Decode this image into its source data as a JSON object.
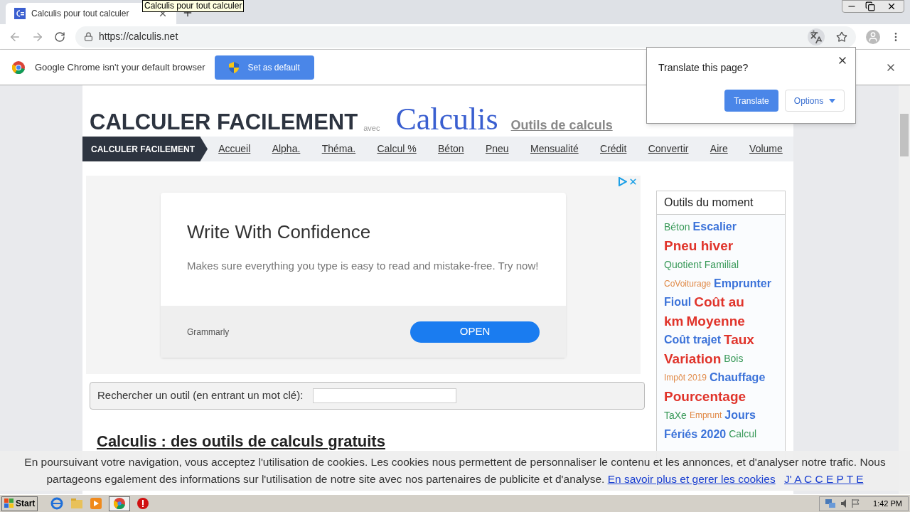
{
  "browser": {
    "tab_title": "Calculis pour tout calculer",
    "tooltip": "Calculis pour tout calculer",
    "url": "https://calculis.net"
  },
  "infobar": {
    "message": "Google Chrome isn't your default browser",
    "button": "Set as default"
  },
  "translate_popup": {
    "title": "Translate this page?",
    "translate_button": "Translate",
    "options_button": "Options"
  },
  "site": {
    "logo_main": "CALCULER FACILEMENT",
    "logo_with": "avec",
    "logo_brand": "Calculis",
    "logo_link": "Outils de calculs"
  },
  "nav": {
    "label": "CALCULER FACILEMENT",
    "items": [
      "Accueil",
      "Alpha.",
      "Théma.",
      "Calcul %",
      "Béton",
      "Pneu",
      "Mensualité",
      "Crédit",
      "Convertir",
      "Aire",
      "Volume"
    ]
  },
  "ad": {
    "title": "Write With Confidence",
    "body": "Makes sure everything you type is easy to read and mistake-free. Try now!",
    "advertiser": "Grammarly",
    "button": "OPEN"
  },
  "search": {
    "label": "Rechercher un outil (en entrant un mot clé):"
  },
  "heading": "Calculis : des outils de calculs gratuits",
  "sidebar": {
    "title": "Outils du moment",
    "lines": [
      [
        {
          "text": "Béton",
          "kind": "small",
          "color": "#3a9a5a"
        },
        {
          "text": "Escalier",
          "kind": "medium",
          "color": "#3b72d9"
        }
      ],
      [
        {
          "text": "Pneu hiver",
          "kind": "large",
          "color": "#e0342b"
        }
      ],
      [
        {
          "text": "Quotient Familial",
          "kind": "small",
          "color": "#3a9a5a"
        }
      ],
      [
        {
          "text": "CoVoiturage",
          "kind": "tiny",
          "color": "#e08845"
        },
        {
          "text": "Emprunter",
          "kind": "medium",
          "color": "#3b72d9"
        }
      ],
      [
        {
          "text": "Fioul",
          "kind": "medium",
          "color": "#3b72d9"
        },
        {
          "text": "Coût au",
          "kind": "large",
          "color": "#e0342b"
        }
      ],
      [
        {
          "text": "km",
          "kind": "large",
          "color": "#e0342b"
        },
        {
          "text": "Moyenne",
          "kind": "large",
          "color": "#e0342b"
        }
      ],
      [
        {
          "text": "Coût trajet",
          "kind": "medium",
          "color": "#3b72d9"
        },
        {
          "text": "Taux",
          "kind": "large",
          "color": "#e0342b"
        }
      ],
      [
        {
          "text": "Variation",
          "kind": "large",
          "color": "#e0342b"
        },
        {
          "text": "Bois",
          "kind": "small",
          "color": "#3a9a5a"
        }
      ],
      [
        {
          "text": "Impôt 2019",
          "kind": "tiny",
          "color": "#e08845"
        },
        {
          "text": "Chauffage",
          "kind": "medium",
          "color": "#3b72d9"
        }
      ],
      [
        {
          "text": "Pourcentage",
          "kind": "large",
          "color": "#e0342b"
        }
      ],
      [
        {
          "text": "TaXe",
          "kind": "small",
          "color": "#3a9a5a"
        },
        {
          "text": "Emprunt",
          "kind": "tiny",
          "color": "#e08845"
        },
        {
          "text": "Jours",
          "kind": "medium",
          "color": "#3b72d9"
        }
      ],
      [
        {
          "text": "Fériés 2020",
          "kind": "medium",
          "color": "#3b72d9"
        },
        {
          "text": "Calcul",
          "kind": "small",
          "color": "#3a9a5a"
        }
      ]
    ]
  },
  "cookie_bar": {
    "message": "En poursuivant votre navigation, vous acceptez l'utilisation de cookies. Les cookies nous permettent de personnaliser le contenu et les annonces, et d'analyser notre trafic. Nous partageons egalement des informations sur l'utilisation de notre site avec nos partenaires de publicite et d'analyse.",
    "more_link": "En savoir plus et gerer les cookies",
    "accept_link": "J' A C C E P T E"
  },
  "taskbar": {
    "start": "Start",
    "time": "1:42 PM"
  }
}
